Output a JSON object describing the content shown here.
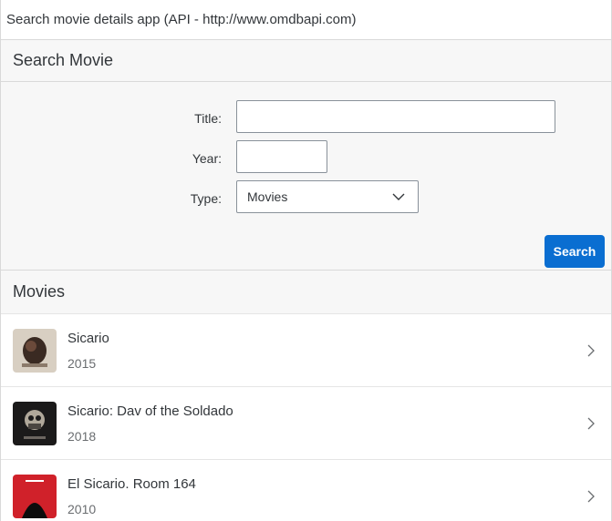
{
  "app": {
    "title": "Search movie details app (API - http://www.omdbapi.com)"
  },
  "search_panel": {
    "title": "Search Movie",
    "fields": {
      "title_label": "Title:",
      "title_value": "",
      "year_label": "Year:",
      "year_value": "",
      "type_label": "Type:",
      "type_value": "Movies"
    },
    "search_button": "Search"
  },
  "results": {
    "title": "Movies",
    "items": [
      {
        "title": "Sicario",
        "year": "2015",
        "poster": "sicario-poster",
        "poster_colors": [
          "#d8cfc2",
          "#3a2a22"
        ]
      },
      {
        "title": "Sicario: Dav of the Soldado",
        "year": "2018",
        "poster": "soldado-poster",
        "poster_colors": [
          "#1b1a1a",
          "#b0a89a"
        ]
      },
      {
        "title": "El Sicario. Room 164",
        "year": "2010",
        "poster": "room164-poster",
        "poster_colors": [
          "#d0212a",
          "#0c0c0c"
        ]
      }
    ]
  },
  "colors": {
    "accent": "#0a6ed1",
    "panel_bg": "#f7f7f7",
    "border": "#d9d9d9",
    "text": "#32363a",
    "muted_text": "#6a6d70"
  }
}
